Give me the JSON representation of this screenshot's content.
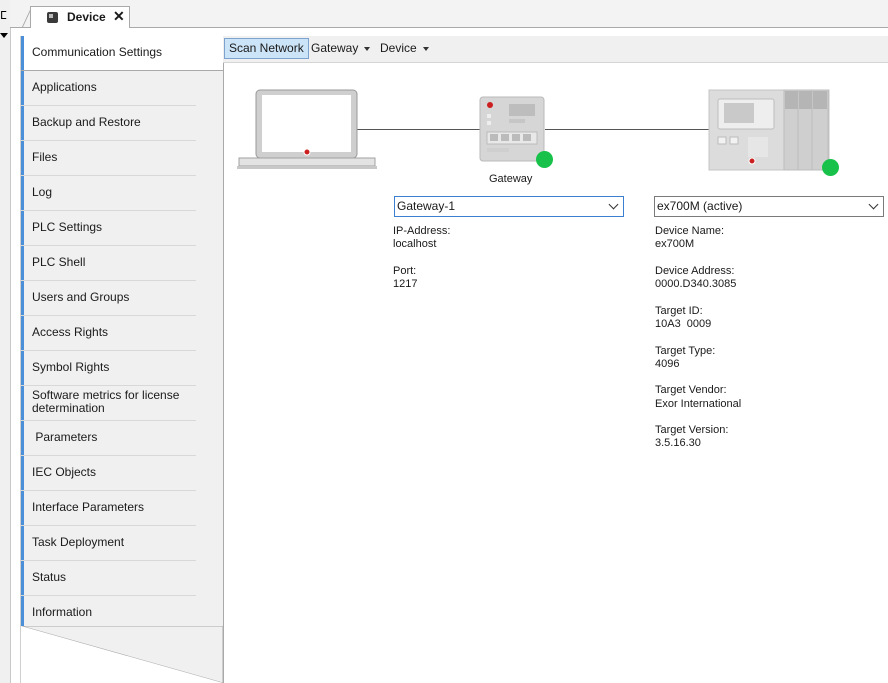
{
  "tab": {
    "title": "Device",
    "close_glyph": "✕"
  },
  "left_strip": {
    "glyph": "ⵎ"
  },
  "sidebar": {
    "items": [
      {
        "label": "Communication Settings"
      },
      {
        "label": "Applications"
      },
      {
        "label": "Backup and Restore"
      },
      {
        "label": "Files"
      },
      {
        "label": "Log"
      },
      {
        "label": "PLC Settings"
      },
      {
        "label": "PLC Shell"
      },
      {
        "label": "Users and Groups"
      },
      {
        "label": "Access Rights"
      },
      {
        "label": "Symbol Rights"
      },
      {
        "label": "Software metrics for license determination"
      },
      {
        "label": " Parameters"
      },
      {
        "label": "IEC Objects"
      },
      {
        "label": "Interface Parameters"
      },
      {
        "label": "Task Deployment"
      },
      {
        "label": "Status"
      },
      {
        "label": "Information"
      }
    ]
  },
  "toolbar": {
    "scan": "Scan Network",
    "gateway": "Gateway",
    "device": "Device"
  },
  "gateway": {
    "caption": "Gateway",
    "selected": "Gateway-1",
    "ip_label": "IP-Address:",
    "ip_value": "localhost",
    "port_label": "Port:",
    "port_value": "1217"
  },
  "device": {
    "selected": "ex700M (active)",
    "name_label": "Device Name:",
    "name_value": "ex700M",
    "addr_label": "Device Address:",
    "addr_value": "0000.D340.3085",
    "tid_label": "Target ID:",
    "tid_value": "10A3  0009",
    "ttype_label": "Target Type:",
    "ttype_value": "4096",
    "tvendor_label": "Target Vendor:",
    "tvendor_value": "Exor International",
    "tversion_label": "Target Version:",
    "tversion_value": "3.5.16.30"
  },
  "colors": {
    "online": "#18c24a",
    "accent": "#4a8fd8",
    "selected_tab_bg": "#cce4f7"
  }
}
